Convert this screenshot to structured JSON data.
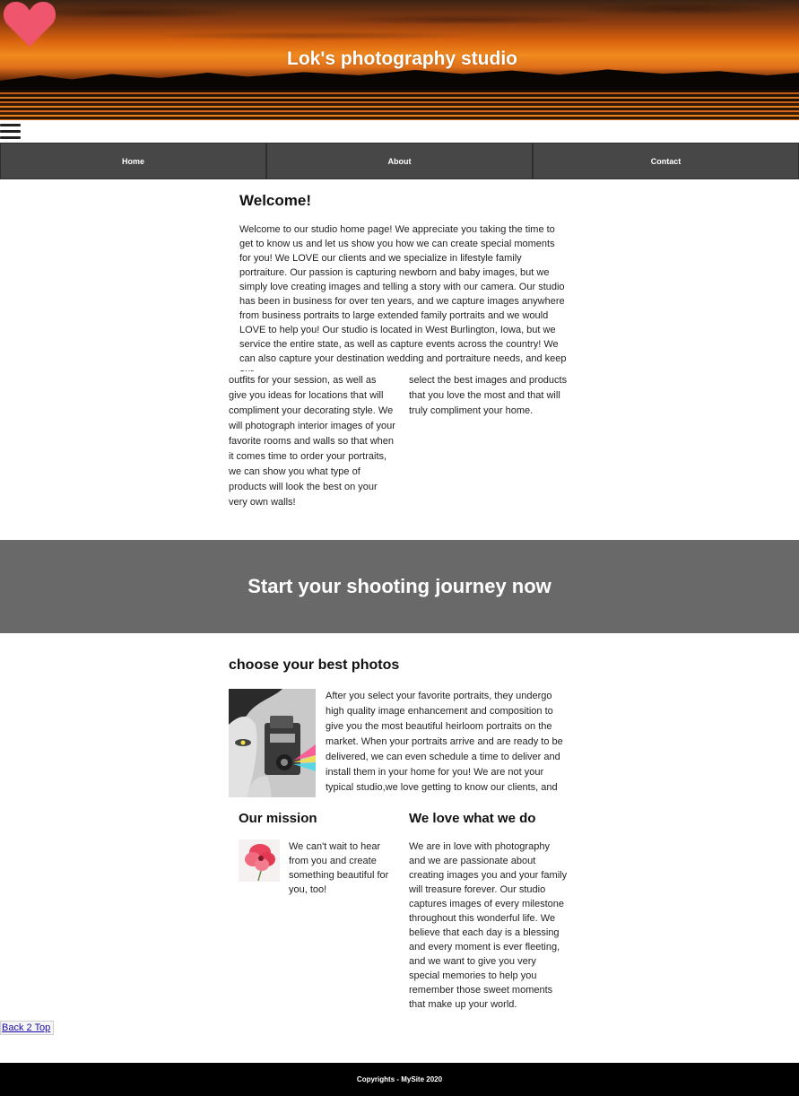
{
  "header": {
    "site_title": "Lok's photography studio",
    "heart_color": "#f0556e"
  },
  "nav": {
    "items": [
      {
        "label": "Home"
      },
      {
        "label": "About"
      },
      {
        "label": "Contact"
      }
    ]
  },
  "welcome": {
    "title": "Welcome!",
    "text": "Welcome to our studio home page! We appreciate you taking the time to get to know us and let us show you how we can create special moments for you! We LOVE our clients and we specialize in lifestyle family portraiture. Our passion is capturing newborn and baby images, but we simply love creating images and telling a story with our camera. Our studio has been in business for over ten years, and we capture images anywhere from business portraits to large extended family portraits and we would LOVE to help you! Our studio is located in West Burlington, Iowa, but we service the entire state, as well as capture events across the country! We can also capture your destination wedding and portraiture needs, and keep our",
    "col_left": "outfits for your session, as well as give you ideas for locations that will compliment your decorating style. We will photograph interior images of your favorite rooms and walls so that when it comes time to order your portraits, we can show you what type of products will look the best on your very own walls!",
    "col_right": "select the best images and products that you love the most and that will truly compliment your home."
  },
  "journey": {
    "title": "Start your shooting journey now"
  },
  "choose": {
    "title": "choose your best photos",
    "text": "After you select your favorite portraits, they undergo high quality image enhancement and composition to give you the most beautiful heirloom portraits on the market. When your portraits arrive and are ready to be delivered, we can even schedule a time to deliver and install them in your home for you! We are not your typical studio,we love getting to know our clients, and"
  },
  "mission": {
    "title": "Our mission",
    "text": "We can't wait to hear from you and create something beautiful for you, too!"
  },
  "love": {
    "title": "We love what we do",
    "text": "We are in love with photography and we are passionate about creating images you and your family will treasure forever. Our studio captures images of every milestone throughout this wonderful life. We believe that each day is a blessing and every moment is ever fleeting, and we want to give you very special memories to help you remember those sweet moments that make up your world."
  },
  "back_to_top": "Back 2 Top",
  "footer": {
    "copyright": "Copyrights - MySite 2020"
  }
}
